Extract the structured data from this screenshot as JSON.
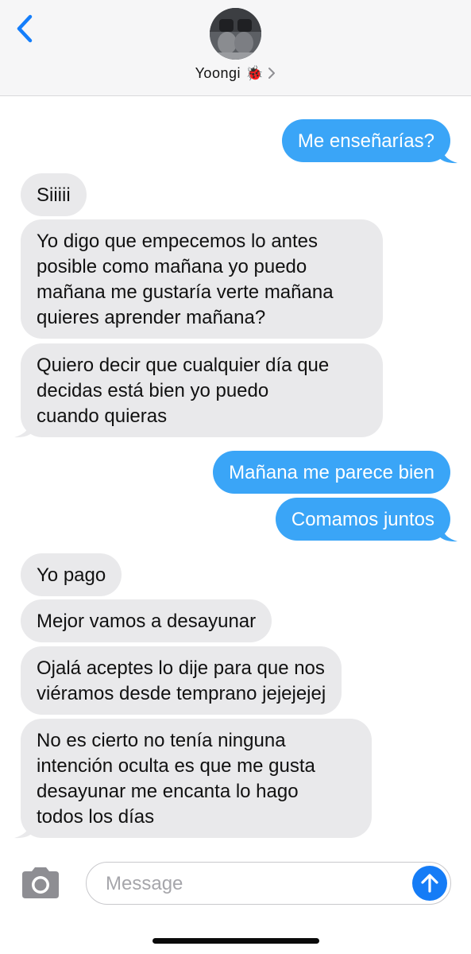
{
  "header": {
    "back_icon": "chevron-left-icon",
    "contact_name": "Yoongi",
    "contact_emoji": "🐞",
    "chevron_icon": "chevron-right-icon",
    "accent_color": "#147efb"
  },
  "messages": [
    {
      "direction": "out",
      "text": "Me enseñarías?"
    },
    {
      "direction": "in",
      "text": "Siiiii"
    },
    {
      "direction": "in",
      "text": "Yo digo que empecemos lo antes\nposible como mañana yo puedo\nmañana me gustaría verte mañana\nquieres aprender mañana?"
    },
    {
      "direction": "in",
      "text": "Quiero decir que cualquier día que\ndecidas está bien yo puedo\ncuando quieras"
    },
    {
      "direction": "out",
      "text": "Mañana me parece bien"
    },
    {
      "direction": "out",
      "text": "Comamos juntos"
    },
    {
      "direction": "in",
      "text": "Yo pago"
    },
    {
      "direction": "in",
      "text": "Mejor vamos a desayunar"
    },
    {
      "direction": "in",
      "text": "Ojalá aceptes lo dije para que nos\nviéramos desde temprano jejejejej"
    },
    {
      "direction": "in",
      "text": "No es cierto no tenía ninguna\nintención oculta es que me gusta\ndesayunar me encanta lo hago\ntodos los días"
    }
  ],
  "composer": {
    "placeholder": "Message",
    "camera_icon": "camera-icon",
    "send_icon": "arrow-up-icon"
  },
  "colors": {
    "outgoing_bubble": "#3aa5f7",
    "incoming_bubble": "#e9e9eb",
    "send_button": "#157cf6"
  }
}
